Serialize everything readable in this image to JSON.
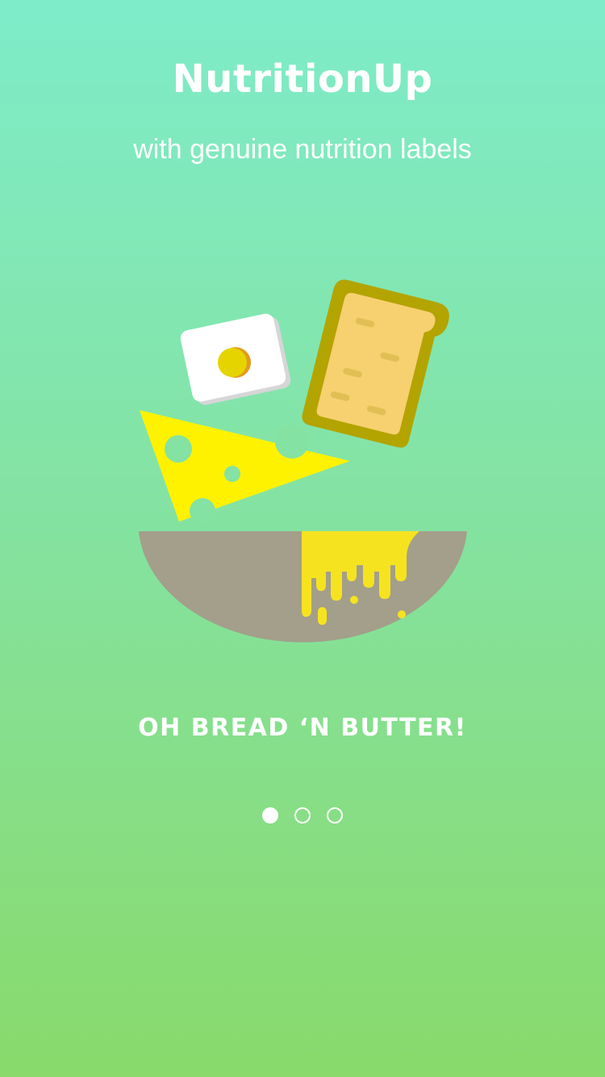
{
  "app": {
    "title": "NutritionUp",
    "subtitle": "with genuine nutrition labels"
  },
  "illustration": {
    "icons": [
      "egg-icon",
      "toast-icon",
      "cheese-icon",
      "bowl-icon",
      "butter-icon"
    ],
    "colors": {
      "cheese": "#fff200",
      "toast_crust": "#b3a400",
      "toast_crumb": "#f7d070",
      "bowl": "#a39f8a",
      "butter": "#f6e320",
      "egg_white": "#ffffff",
      "egg_yolk": "#e6d400"
    }
  },
  "slide": {
    "heading": "OH BREAD ‘N BUTTER!"
  },
  "pager": {
    "count": 3,
    "active_index": 0
  },
  "theme": {
    "gradient_top": "#7eecc9",
    "gradient_bottom": "#89da6b",
    "text_color": "#ffffff"
  }
}
